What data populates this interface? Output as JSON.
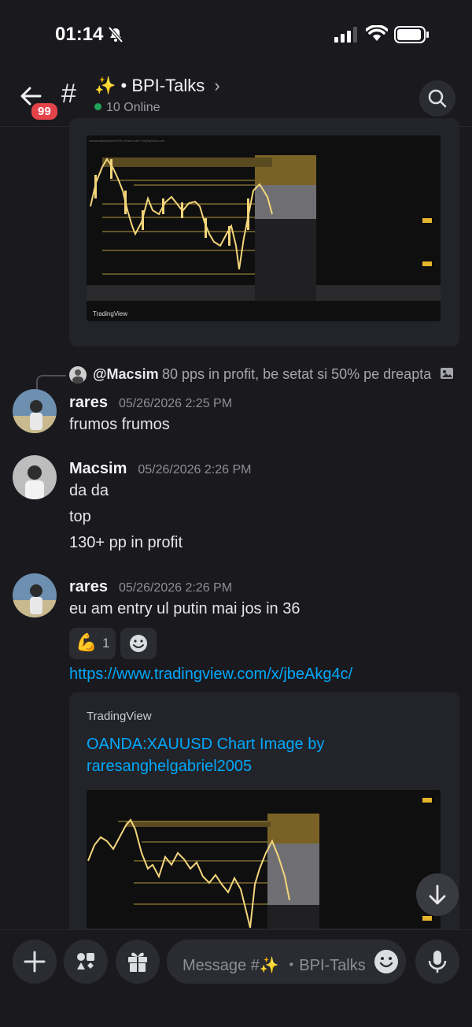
{
  "status_bar": {
    "time": "01:14"
  },
  "header": {
    "back_badge": "99",
    "hash": "#",
    "channel_name": "✨ • BPI-Talks",
    "chevron": "›",
    "online_text": "10 Online"
  },
  "reply": {
    "author": "@Macsim",
    "text": "80 pps in profit, be setat si 50% pe dreapta"
  },
  "messages": [
    {
      "author": "rares",
      "timestamp": "05/26/2026 2:25 PM",
      "lines": [
        "frumos frumos"
      ]
    },
    {
      "author": "Macsim",
      "timestamp": "05/26/2026 2:26 PM",
      "lines": [
        "da da",
        "top",
        "130+ pp in profit"
      ]
    },
    {
      "author": "rares",
      "timestamp": "05/26/2026 2:26 PM",
      "lines": [
        "eu am entry ul putin mai jos in 36"
      ]
    }
  ],
  "reactions": [
    {
      "emoji": "💪",
      "count": "1"
    }
  ],
  "link": "https://www.tradingview.com/x/jbeAkg4c/",
  "embed": {
    "provider": "TradingView",
    "title_line1": "OANDA:XAUUSD Chart Image by",
    "title_line2": "raresanghelgabriel2005"
  },
  "embed_top": {
    "provider_logo": "TradingView"
  },
  "composer": {
    "placeholder": "Message #✨ ・BPI-Talks"
  },
  "colors": {
    "accent_link": "#00a8fc",
    "online": "#23a559",
    "badge": "#e5434a"
  }
}
